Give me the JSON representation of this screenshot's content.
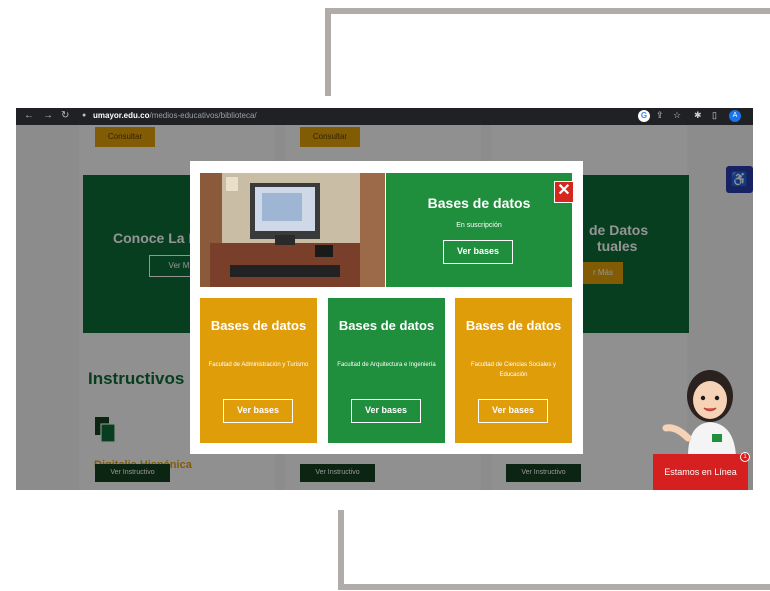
{
  "browser": {
    "url_domain": "umayor.edu.co",
    "url_path": "/medios-educativos/biblioteca/",
    "profile_initial": "A"
  },
  "page": {
    "consultar_1": "Consultar",
    "consultar_2": "Consultar",
    "banner_left_title": "Conoce La B",
    "banner_left_button": "Ver M",
    "banner_right_title_1": "de Datos",
    "banner_right_title_2": "tuales",
    "banner_right_button": "r Más",
    "instructivos_heading": "Instructivos",
    "digitalia_title": "Digitalia Hispánica",
    "ver_instructivo_1": "Ver Instructivo",
    "ver_instructivo_2": "Ver Instructivo",
    "ver_instructivo_3": "Ver Instructivo"
  },
  "modal": {
    "top": {
      "title": "Bases de datos",
      "subtitle": "En suscripción",
      "button": "Ver bases"
    },
    "close_glyph": "✕",
    "cards": [
      {
        "title": "Bases de datos",
        "subtitle": "Facultad de Administración y Turismo",
        "button": "Ver bases",
        "color": "#e09d0a"
      },
      {
        "title": "Bases de datos",
        "subtitle": "Facultad de Arquitectura e Ingeniería",
        "button": "Ver bases",
        "color": "#1f8f3d"
      },
      {
        "title": "Bases de datos",
        "subtitle": "Facultad de Ciencias Sociales y Educación",
        "button": "Ver bases",
        "color": "#e09d0a"
      }
    ]
  },
  "chat": {
    "label": "Estamos en Línea",
    "count": "1"
  },
  "icons": [
    "back-arrow-icon",
    "forward-arrow-icon",
    "reload-icon",
    "lock-icon",
    "google-icon",
    "share-icon",
    "star-icon",
    "extension-icon",
    "sidebar-icon",
    "accessibility-icon",
    "close-icon",
    "document-icon"
  ],
  "colors": {
    "green": "#1f8f3d",
    "dark_green": "#0e6b37",
    "orange": "#e09d0a",
    "red": "#d6271f",
    "accessibility_blue": "#2a3caa"
  }
}
